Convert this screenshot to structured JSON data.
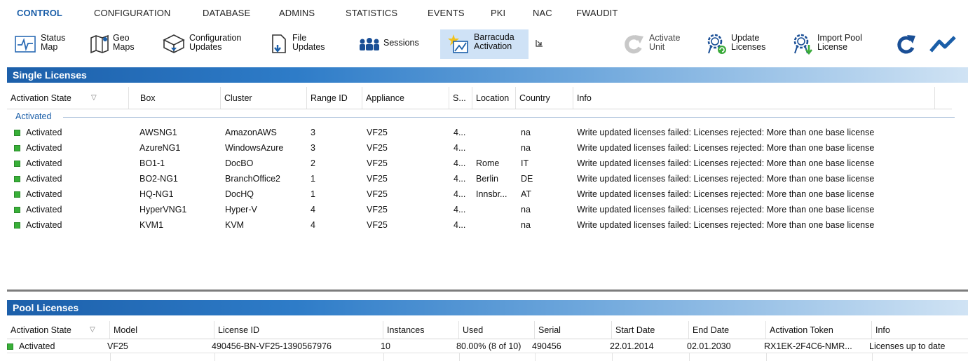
{
  "menu": [
    {
      "id": "control",
      "label": "CONTROL",
      "active": true
    },
    {
      "id": "configuration",
      "label": "CONFIGURATION"
    },
    {
      "id": "database",
      "label": "DATABASE"
    },
    {
      "id": "admins",
      "label": "ADMINS"
    },
    {
      "id": "statistics",
      "label": "STATISTICS"
    },
    {
      "id": "events",
      "label": "EVENTS"
    },
    {
      "id": "pki",
      "label": "PKI"
    },
    {
      "id": "nac",
      "label": "NAC"
    },
    {
      "id": "fwaudit",
      "label": "FWAUDIT"
    }
  ],
  "toolbar": {
    "status_map": "Status\nMap",
    "geo_maps": "Geo\nMaps",
    "config_updates": "Configuration\nUpdates",
    "file_updates": "File\nUpdates",
    "sessions": "Sessions",
    "barracuda_activation": "Barracuda\nActivation",
    "activate_unit": "Activate\nUnit",
    "update_licenses": "Update\nLicenses",
    "import_pool_license": "Import Pool\nLicense"
  },
  "single": {
    "title": "Single Licenses",
    "columns": [
      "Activation State",
      "Box",
      "Cluster",
      "Range ID",
      "Appliance",
      "S...",
      "Location",
      "Country",
      "Info"
    ],
    "group_label": "Activated",
    "rows": [
      {
        "state": "Activated",
        "box": "AWSNG1",
        "cluster": "AmazonAWS",
        "range": "3",
        "appliance": "VF25",
        "s": "4...",
        "location": "",
        "country": "na",
        "info": "Write updated licenses failed: Licenses rejected: More than one base license"
      },
      {
        "state": "Activated",
        "box": "AzureNG1",
        "cluster": "WindowsAzure",
        "range": "3",
        "appliance": "VF25",
        "s": "4...",
        "location": "",
        "country": "na",
        "info": "Write updated licenses failed: Licenses rejected: More than one base license"
      },
      {
        "state": "Activated",
        "box": "BO1-1",
        "cluster": "DocBO",
        "range": "2",
        "appliance": "VF25",
        "s": "4...",
        "location": "Rome",
        "country": "IT",
        "info": "Write updated licenses failed: Licenses rejected: More than one base license"
      },
      {
        "state": "Activated",
        "box": "BO2-NG1",
        "cluster": "BranchOffice2",
        "range": "1",
        "appliance": "VF25",
        "s": "4...",
        "location": "Berlin",
        "country": "DE",
        "info": "Write updated licenses failed: Licenses rejected: More than one base license"
      },
      {
        "state": "Activated",
        "box": "HQ-NG1",
        "cluster": "DocHQ",
        "range": "1",
        "appliance": "VF25",
        "s": "4...",
        "location": "Innsbr...",
        "country": "AT",
        "info": "Write updated licenses failed: Licenses rejected: More than one base license"
      },
      {
        "state": "Activated",
        "box": "HyperVNG1",
        "cluster": "Hyper-V",
        "range": "4",
        "appliance": "VF25",
        "s": "4...",
        "location": "",
        "country": "na",
        "info": "Write updated licenses failed: Licenses rejected: More than one base license"
      },
      {
        "state": "Activated",
        "box": "KVM1",
        "cluster": "KVM",
        "range": "4",
        "appliance": "VF25",
        "s": "4...",
        "location": "",
        "country": "na",
        "info": "Write updated licenses failed: Licenses rejected: More than one base license"
      }
    ]
  },
  "pool": {
    "title": "Pool Licenses",
    "columns": [
      "Activation State",
      "Model",
      "License ID",
      "Instances",
      "Used",
      "Serial",
      "Start Date",
      "End Date",
      "Activation Token",
      "Info"
    ],
    "rows": [
      {
        "state": "Activated",
        "model": "VF25",
        "license_id": "490456-BN-VF25-1390567976",
        "instances": "10",
        "used": "80.00% (8 of 10)",
        "serial": "490456",
        "start": "22.01.2014",
        "end": "02.01.2030",
        "token": "RX1EK-2F4C6-NMR...",
        "info": "Licenses up to date"
      }
    ]
  },
  "colors": {
    "accent": "#1a5ea8",
    "status_green": "#38b038",
    "selected_bg": "#cfe2f6"
  }
}
